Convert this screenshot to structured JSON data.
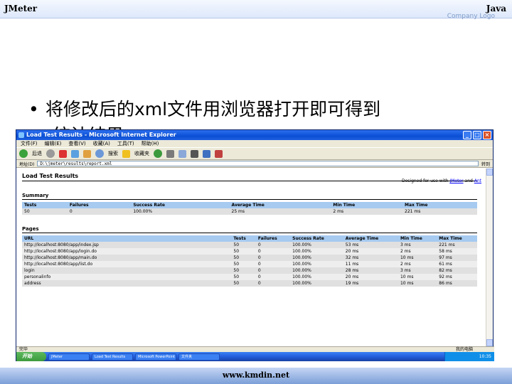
{
  "slide": {
    "top_left": "JMeter",
    "top_right": "Java",
    "company_logo": "Company Logo",
    "bullet_line1": "将修改后的xml文件用浏览器打开即可得到",
    "bullet_line2": "统计结果",
    "footer": "www.kmdin.net"
  },
  "ie": {
    "title": "Load Test Results - Microsoft Internet Explorer",
    "menu": [
      "文件(F)",
      "编辑(E)",
      "查看(V)",
      "收藏(A)",
      "工具(T)",
      "帮助(H)"
    ],
    "toolbar": {
      "back": "后退",
      "search": "搜索",
      "favorites": "收藏夹"
    },
    "address_label": "地址(D)",
    "address": "D:\\jmeter\\results\\report.xml",
    "go_label": "转到",
    "status_left": "完毕",
    "status_zone": "我的电脑"
  },
  "report": {
    "title": "Load Test Results",
    "designed_for": "Designed for use with",
    "designed_link1": "JMeter",
    "designed_and": "and",
    "designed_link2": "Ant",
    "summary_heading": "Summary",
    "summary_headers": [
      "Tests",
      "Failures",
      "Success Rate",
      "Average Time",
      "Min Time",
      "Max Time"
    ],
    "summary_row": [
      "50",
      "0",
      "100.00%",
      "25 ms",
      "2 ms",
      "221 ms"
    ],
    "pages_heading": "Pages",
    "pages_headers": [
      "URL",
      "Tests",
      "Failures",
      "Success Rate",
      "Average Time",
      "Min Time",
      "Max Time"
    ],
    "pages_rows": [
      [
        "http://localhost:8080/app/index.jsp",
        "50",
        "0",
        "100.00%",
        "53 ms",
        "3 ms",
        "221 ms"
      ],
      [
        "http://localhost:8080/app/login.do",
        "50",
        "0",
        "100.00%",
        "20 ms",
        "2 ms",
        "58 ms"
      ],
      [
        "http://localhost:8080/app/main.do",
        "50",
        "0",
        "100.00%",
        "32 ms",
        "10 ms",
        "97 ms"
      ],
      [
        "http://localhost:8080/app/list.do",
        "50",
        "0",
        "100.00%",
        "11 ms",
        "2 ms",
        "61 ms"
      ],
      [
        "login",
        "50",
        "0",
        "100.00%",
        "28 ms",
        "3 ms",
        "82 ms"
      ],
      [
        "personalinfo",
        "50",
        "0",
        "100.00%",
        "20 ms",
        "10 ms",
        "92 ms"
      ],
      [
        "address",
        "50",
        "0",
        "100.00%",
        "19 ms",
        "10 ms",
        "86 ms"
      ]
    ]
  },
  "taskbar": {
    "start": "开始",
    "items": [
      "JMeter",
      "Load Test Results",
      "Microsoft PowerPoint",
      "文件夹"
    ],
    "clock": "10:35"
  }
}
